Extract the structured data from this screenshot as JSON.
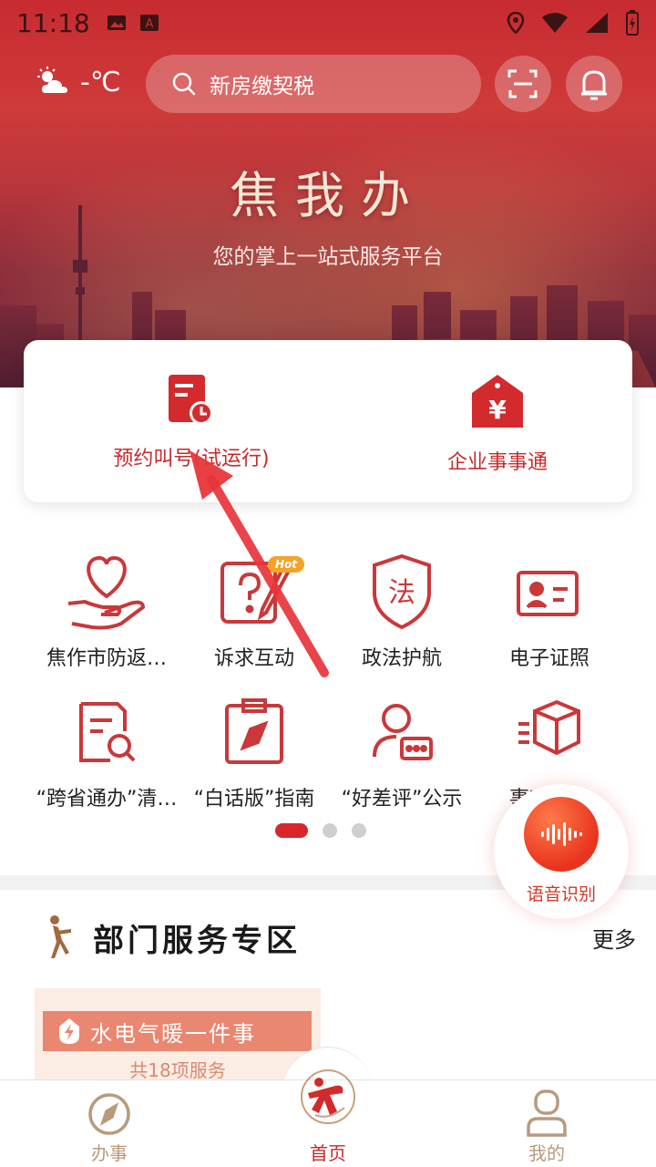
{
  "status_bar": {
    "time": "11:18"
  },
  "header": {
    "temperature": "-℃",
    "search_placeholder": "新房缴契税",
    "icons": [
      "weather-icon",
      "search-icon",
      "scan-icon",
      "bell-icon"
    ]
  },
  "hero": {
    "title": "焦我办",
    "subtitle": "您的掌上一站式服务平台"
  },
  "quick_services": [
    {
      "label": "预约叫号(试运行)",
      "icon": "appointment-icon"
    },
    {
      "label": "企业事事通",
      "icon": "enterprise-icon"
    }
  ],
  "service_grid": [
    {
      "label": "焦作市防返…",
      "icon": "heart-hand-icon"
    },
    {
      "label": "诉求互动",
      "icon": "question-pen-icon",
      "badge": "Hot"
    },
    {
      "label": "政法护航",
      "icon": "law-shield-icon"
    },
    {
      "label": "电子证照",
      "icon": "id-card-icon"
    },
    {
      "label": "“跨省通办”清…",
      "icon": "document-search-icon"
    },
    {
      "label": "“白话版”指南",
      "icon": "clipboard-compass-icon"
    },
    {
      "label": "“好差评”公示",
      "icon": "user-message-icon"
    },
    {
      "label": "事项…录",
      "icon": "box-list-icon"
    }
  ],
  "pager": {
    "pages": 3,
    "active": 0
  },
  "voice": {
    "label": "语音识别"
  },
  "department": {
    "title": "部门服务专区",
    "more": "更多",
    "card": {
      "name": "水电气暖一件事",
      "count": "共18项服务"
    }
  },
  "tabbar": [
    {
      "label": "办事",
      "icon": "compass-icon",
      "active": false
    },
    {
      "label": "首页",
      "icon": "home-logo-icon",
      "active": true
    },
    {
      "label": "我的",
      "icon": "user-icon",
      "active": false
    }
  ],
  "colors": {
    "brand_red": "#c42b2b",
    "accent_gold": "#b89a7d",
    "hot_badge": "#f3a428"
  }
}
